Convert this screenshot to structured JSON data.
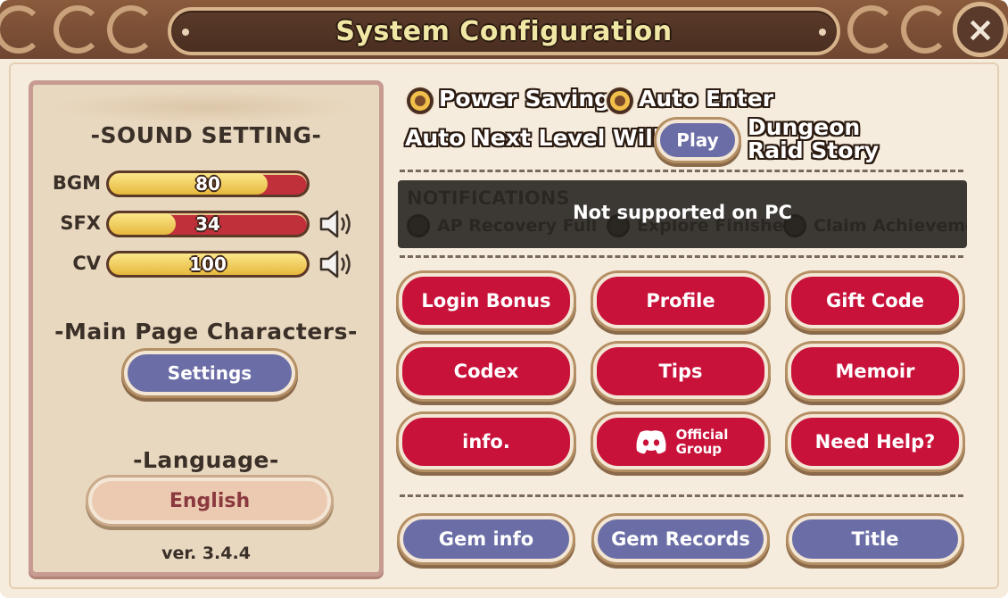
{
  "title": "System Configuration",
  "close_icon": "×",
  "sound": {
    "heading": "-SOUND SETTING-",
    "sliders": [
      {
        "label": "BGM",
        "value": "80",
        "level": 0.8,
        "muted_icon": false
      },
      {
        "label": "SFX",
        "value": "34",
        "level": 0.34,
        "muted_icon": true
      },
      {
        "label": "CV",
        "value": "100",
        "level": 1.0,
        "muted_icon": true
      }
    ]
  },
  "main_page": {
    "heading": "-Main Page Characters-",
    "settings_label": "Settings"
  },
  "language": {
    "heading": "-Language-",
    "value": "English"
  },
  "version": "ver. 3.4.4",
  "options": {
    "power_saving": "Power Saving",
    "auto_enter": "Auto Enter",
    "auto_next_label": "Auto Next Level Will",
    "play_label": "Play",
    "dungeon_line1": "Dungeon",
    "dungeon_line2": "Raid Story"
  },
  "notifications": {
    "title": "NOTIFICATIONS",
    "items": [
      "AP Recovery Full",
      "Explore Finished",
      "Claim Achievement"
    ],
    "message": "Not supported on PC"
  },
  "grid": {
    "login_bonus": "Login Bonus",
    "profile": "Profile",
    "gift_code": "Gift Code",
    "codex": "Codex",
    "tips": "Tips",
    "memoir": "Memoir",
    "info": "info.",
    "official_line1": "Official",
    "official_line2": "Group",
    "need_help": "Need Help?"
  },
  "bottom": {
    "gem_info": "Gem info",
    "gem_records": "Gem Records",
    "title": "Title"
  },
  "colors": {
    "red_button": "#c8123a",
    "blue_button": "#6b6ea6",
    "frame_brown": "#5b3b2a",
    "title_text": "#f1e7a4"
  }
}
